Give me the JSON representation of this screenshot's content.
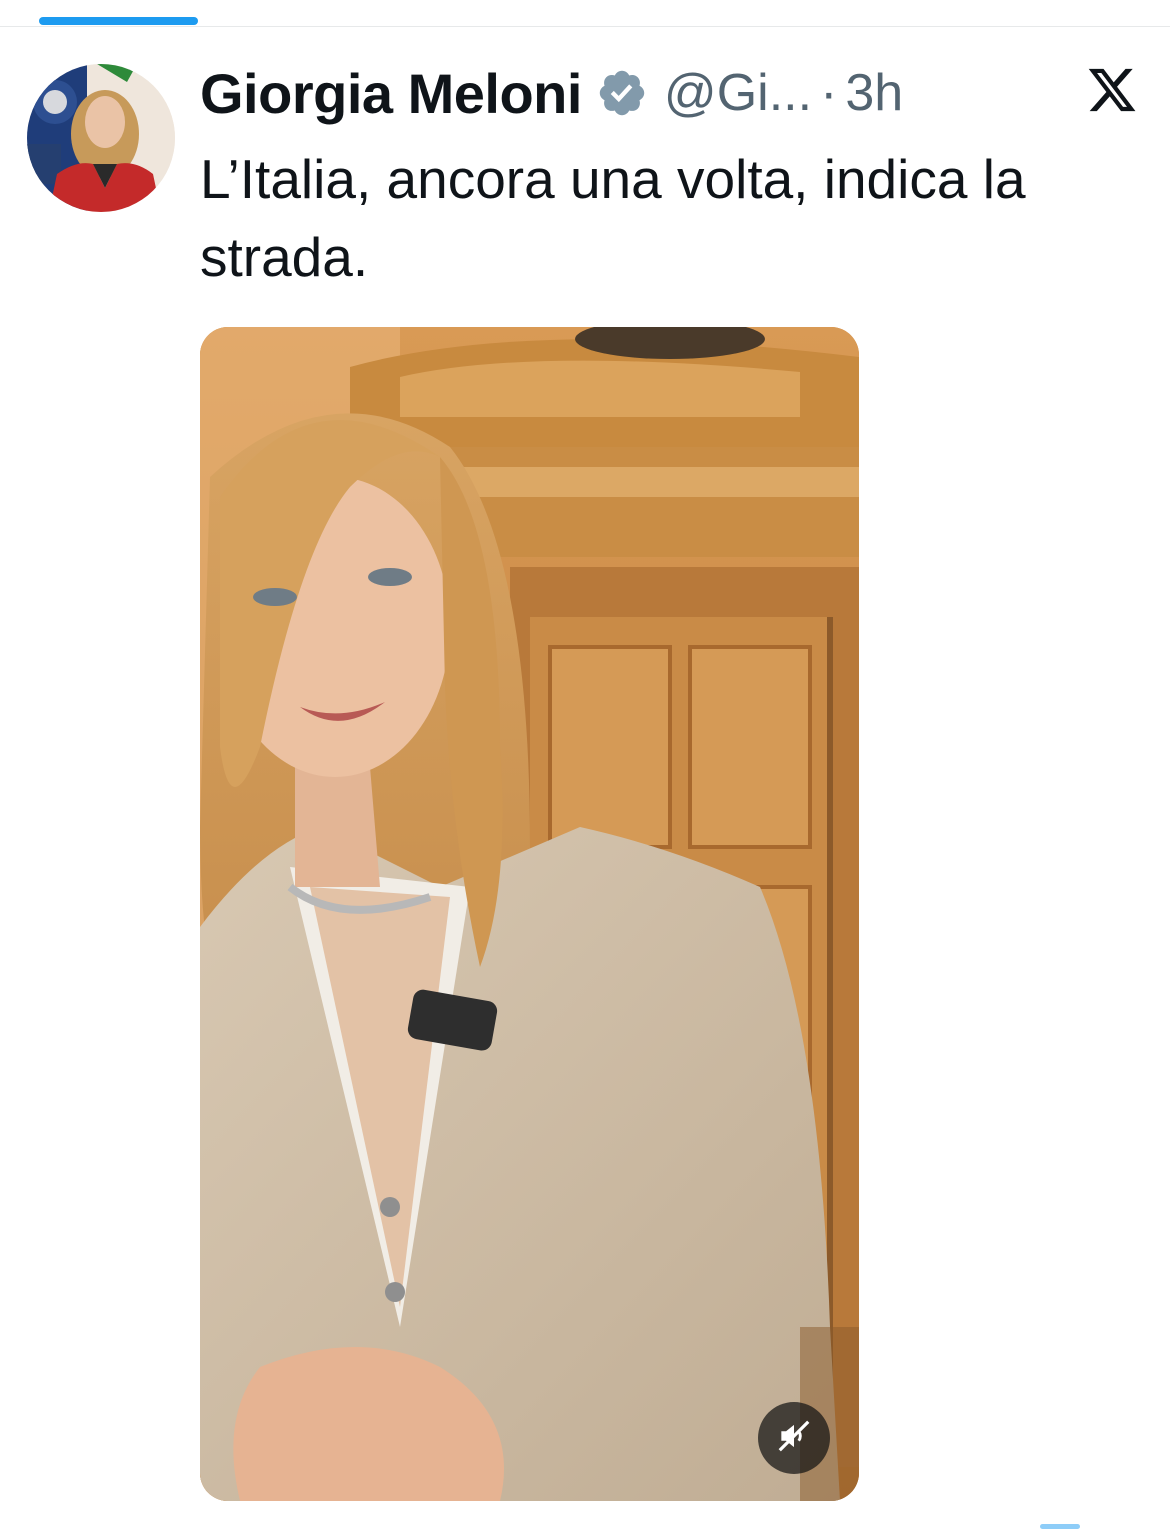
{
  "app": {
    "accent_color": "#1d9bf0",
    "text_color": "#0f1419",
    "secondary_text_color": "#536471"
  },
  "tweet": {
    "author": {
      "display_name": "Giorgia Meloni",
      "handle": "@Gi...",
      "verified": true,
      "verified_badge_color": "#829aab",
      "avatar_icon": "profile-photo"
    },
    "separator": "·",
    "timestamp": "3h",
    "text": "L’Italia, ancora una volta, indica la strada.",
    "media": {
      "type": "video",
      "muted": true,
      "mute_icon": "speaker-muted-icon"
    }
  },
  "platform_logo": "x-logo-icon"
}
